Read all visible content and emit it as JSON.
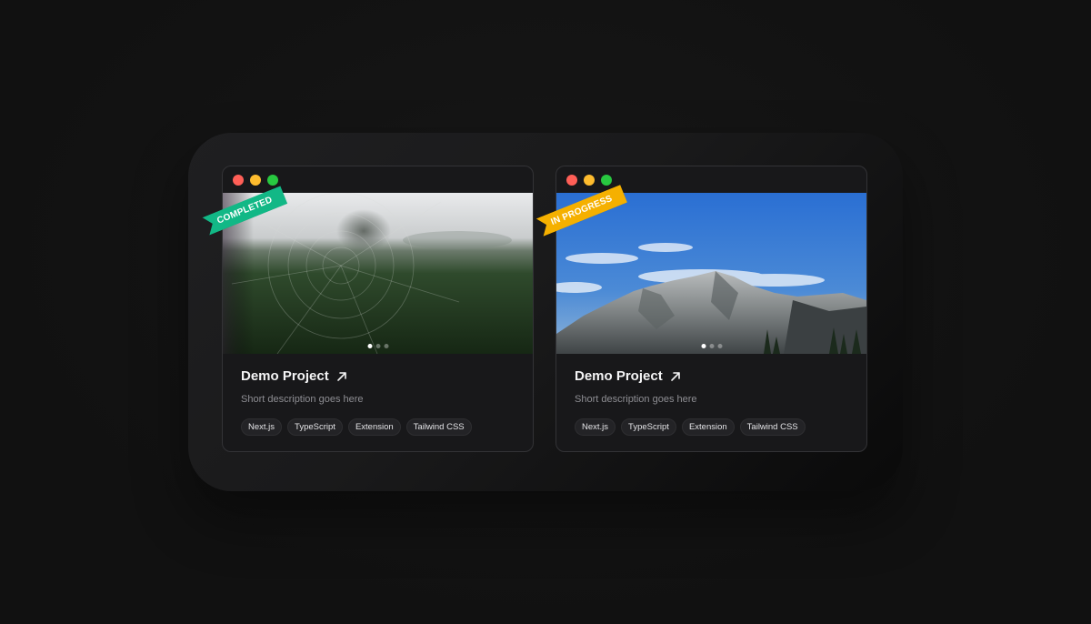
{
  "cards": [
    {
      "status": "COMPLETED",
      "status_color": "#12b886",
      "image": "misty-field-spiderweb",
      "title": "Demo Project",
      "link_icon": "arrow-up-right-icon",
      "description": "Short description goes here",
      "tags": [
        "Next.js",
        "TypeScript",
        "Extension",
        "Tailwind CSS"
      ],
      "carousel": {
        "count": 3,
        "active": 1
      }
    },
    {
      "status": "IN PROGRESS",
      "status_color": "#f5b000",
      "image": "mountain-blue-sky",
      "title": "Demo Project",
      "link_icon": "arrow-up-right-icon",
      "description": "Short description goes here",
      "tags": [
        "Next.js",
        "TypeScript",
        "Extension",
        "Tailwind CSS"
      ],
      "carousel": {
        "count": 3,
        "active": 1
      }
    }
  ],
  "window_controls": [
    "#ff5f57",
    "#febc2e",
    "#28c840"
  ]
}
